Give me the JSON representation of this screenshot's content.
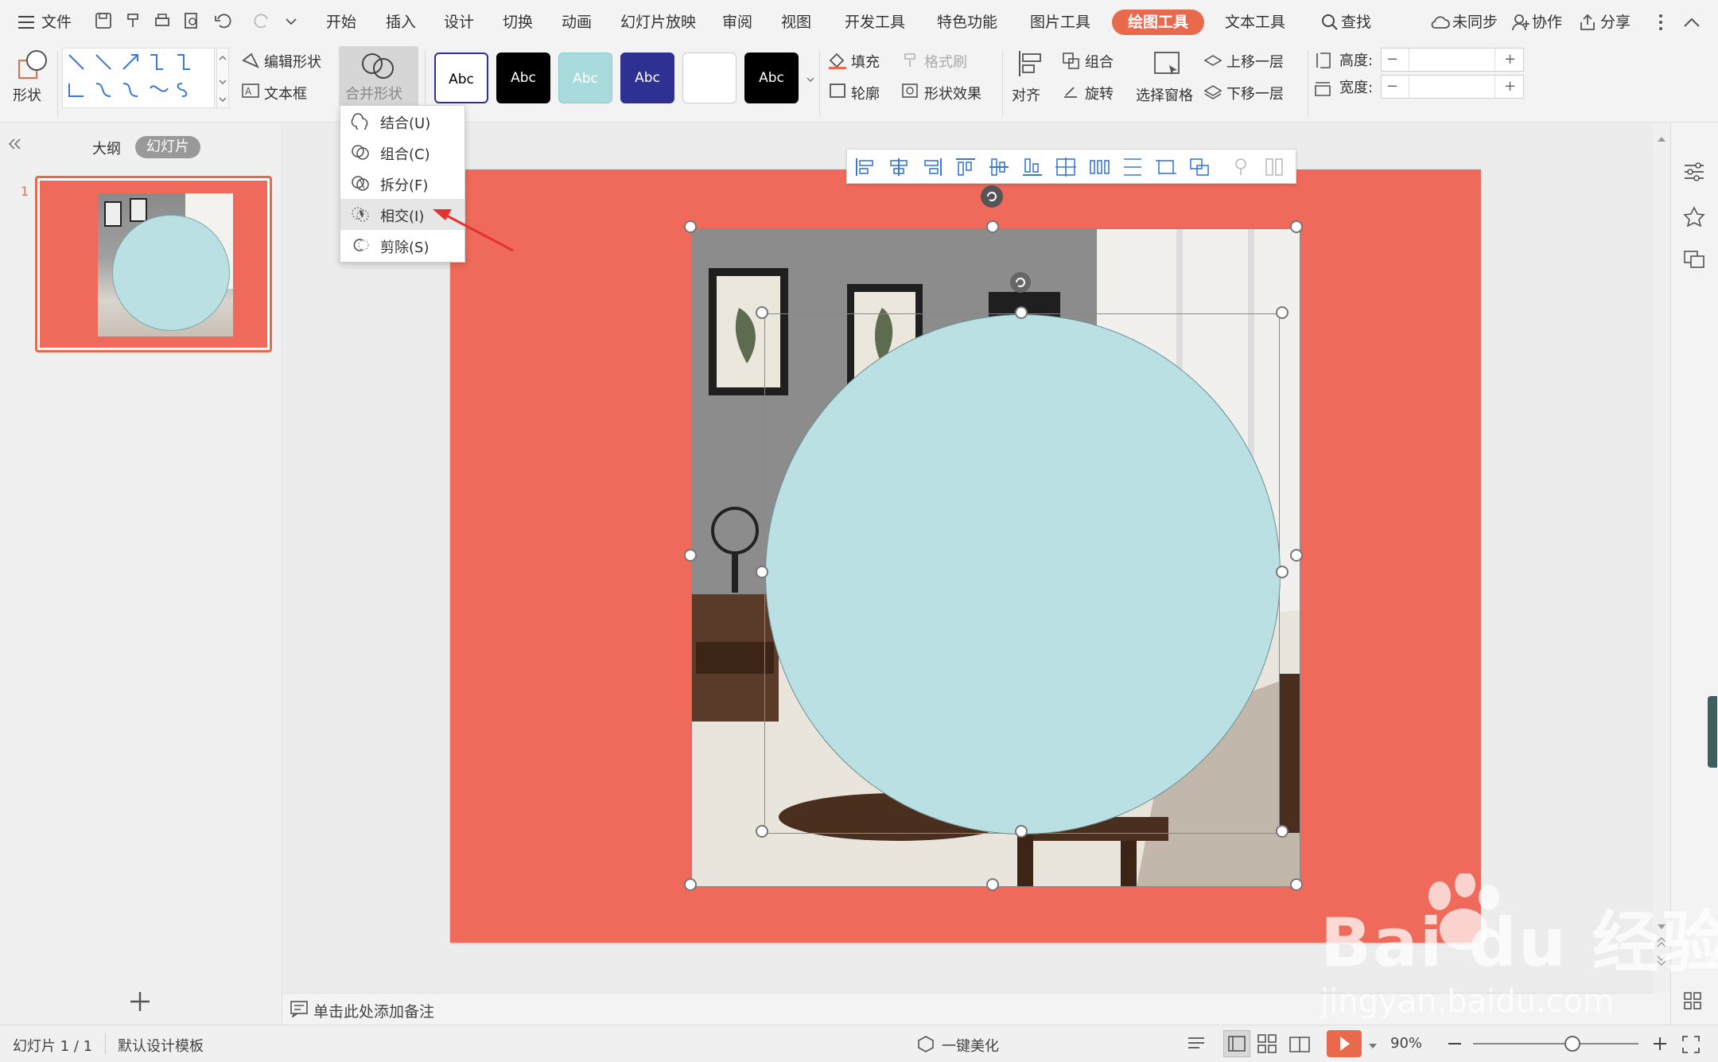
{
  "menu": {
    "file": "文件",
    "tabs": [
      "开始",
      "插入",
      "设计",
      "切换",
      "动画",
      "幻灯片放映",
      "审阅",
      "视图",
      "开发工具",
      "特色功能",
      "图片工具",
      "绘图工具",
      "文本工具"
    ],
    "search": "查找",
    "sync": "未同步",
    "collab": "协作",
    "share": "分享"
  },
  "ribbon": {
    "shape": "形状",
    "edit_shape": "编辑形状",
    "textbox": "文本框",
    "merge_shape": "合并形状",
    "style_sample": "Abc",
    "fill": "填充",
    "format_painter": "格式刷",
    "outline": "轮廓",
    "shape_effect": "形状效果",
    "align": "对齐",
    "group": "组合",
    "rotate": "旋转",
    "selection_pane": "选择窗格",
    "bring_forward": "上移一层",
    "send_backward": "下移一层",
    "height_label": "高度:",
    "width_label": "宽度:"
  },
  "dropdown": {
    "items": [
      "结合(U)",
      "组合(C)",
      "拆分(F)",
      "相交(I)",
      "剪除(S)"
    ],
    "highlighted": 3
  },
  "panel": {
    "outline_tab": "大纲",
    "slides_tab": "幻灯片",
    "slide_number": "1"
  },
  "notes": {
    "placeholder": "单击此处添加备注"
  },
  "status": {
    "slide_info": "幻灯片 1 / 1",
    "template": "默认设计模板",
    "beautify": "一键美化",
    "zoom": "90%",
    "zoom_level": 0.6
  },
  "watermark": {
    "brand": "Bai  du 经验",
    "url": "jingyan.baidu.com"
  },
  "colors": {
    "accent": "#e8694b",
    "slide_bg": "#ef6a5a",
    "circle": "#bbe0e3",
    "dark_blue": "#2e3192"
  }
}
